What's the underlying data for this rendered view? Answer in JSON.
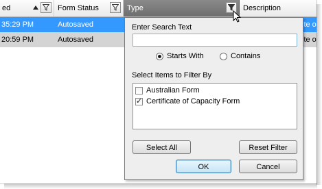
{
  "grid": {
    "columns": [
      {
        "label": "ed"
      },
      {
        "label": "Form Status"
      },
      {
        "label": "Type"
      },
      {
        "label": "Description"
      }
    ],
    "rows": [
      {
        "time": "35:29 PM",
        "status": "Autosaved",
        "desc_tail": "ite o"
      },
      {
        "time": "20:59 PM",
        "status": "Autosaved",
        "desc_tail": "ite o"
      }
    ]
  },
  "filter_popup": {
    "search_label": "Enter Search Text",
    "search_value": "",
    "radio_starts_with": "Starts With",
    "radio_contains": "Contains",
    "selected_mode": "Starts With",
    "items_label": "Select Items to Filter By",
    "items": [
      {
        "label": "Australian Form",
        "checked": false
      },
      {
        "label": "Certificate of Capacity Form",
        "checked": true
      }
    ],
    "select_all": "Select All",
    "reset_filter": "Reset Filter",
    "ok": "OK",
    "cancel": "Cancel"
  },
  "colors": {
    "selected_row": "#3399ff",
    "secondary_row": "#d4d4d4",
    "active_header": "#7a7a7a",
    "popup_bg": "#eeeeee"
  },
  "icons": {
    "filter": "filter-funnel-icon",
    "sort": "sort-ascending-icon",
    "cursor": "mouse-pointer-icon"
  }
}
